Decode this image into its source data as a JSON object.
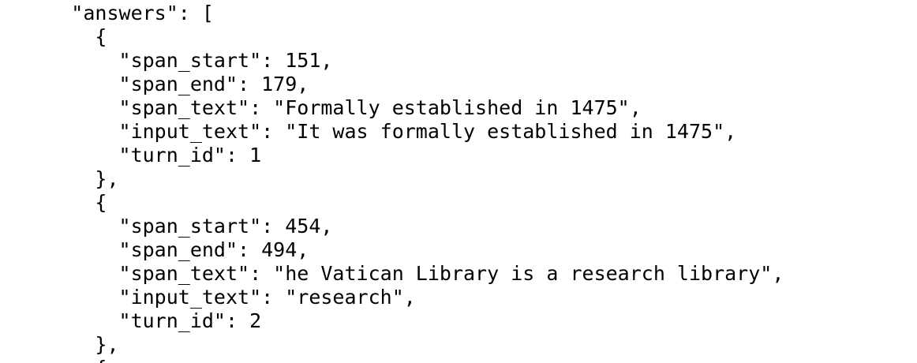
{
  "lines": [
    "      \"answers\": [",
    "        {",
    "          \"span_start\": 151,",
    "          \"span_end\": 179,",
    "          \"span_text\": \"Formally established in 1475\",",
    "          \"input_text\": \"It was formally established in 1475\",",
    "          \"turn_id\": 1",
    "        },",
    "        {",
    "          \"span_start\": 454,",
    "          \"span_end\": 494,",
    "          \"span_text\": \"he Vatican Library is a research library\",",
    "          \"input_text\": \"research\",",
    "          \"turn_id\": 2",
    "        },",
    "        {"
  ]
}
